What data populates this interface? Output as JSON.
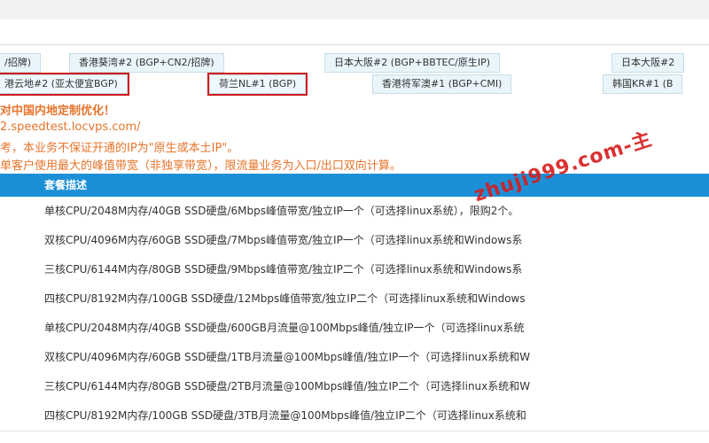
{
  "tabs": {
    "row1": [
      "/招牌)",
      "香港葵湾#2 (BGP+CN2/招牌)",
      "日本大阪#2 (BGP+BBTEC/原生IP)",
      "日本大阪#2"
    ],
    "row2": [
      "港云地#2 (亚太便宜BGP)",
      "荷兰NL#1 (BGP)",
      "香港将军澳#1 (BGP+CMI)",
      "韩国KR#1 (B"
    ]
  },
  "notes": [
    "对中国内地定制优化！",
    "2.speedtest.locvps.com/",
    "考，本业务不保证开通的IP为\"原生或本土IP\"。",
    "单客户使用最大的峰值带宽（非独享带宽），限流量业务为入口/出口双向计算。"
  ],
  "table": {
    "header": "套餐描述",
    "rows": [
      "单核CPU/2048M内存/40GB SSD硬盘/6Mbps峰值带宽/独立IP一个（可选择linux系统），限购2个。",
      "双核CPU/4096M内存/60GB SSD硬盘/7Mbps峰值带宽/独立IP一个（可选择linux系统和Windows系",
      "三核CPU/6144M内存/80GB SSD硬盘/9Mbps峰值带宽/独立IP二个（可选择linux系统和Windows系",
      "四核CPU/8192M内存/100GB SSD硬盘/12Mbps峰值带宽/独立IP二个（可选择linux系统和Windows",
      "单核CPU/2048M内存/40GB SSD硬盘/600GB月流量@100Mbps峰值/独立IP一个（可选择linux系统",
      "双核CPU/4096M内存/60GB SSD硬盘/1TB月流量@100Mbps峰值/独立IP一个（可选择linux系统和W",
      "三核CPU/6144M内存/80GB SSD硬盘/2TB月流量@100Mbps峰值/独立IP二个（可选择linux系统和W",
      "四核CPU/8192M内存/100GB SSD硬盘/3TB月流量@100Mbps峰值/独立IP二个（可选择linux系统和"
    ]
  },
  "watermark": "zhuji999.com-主"
}
